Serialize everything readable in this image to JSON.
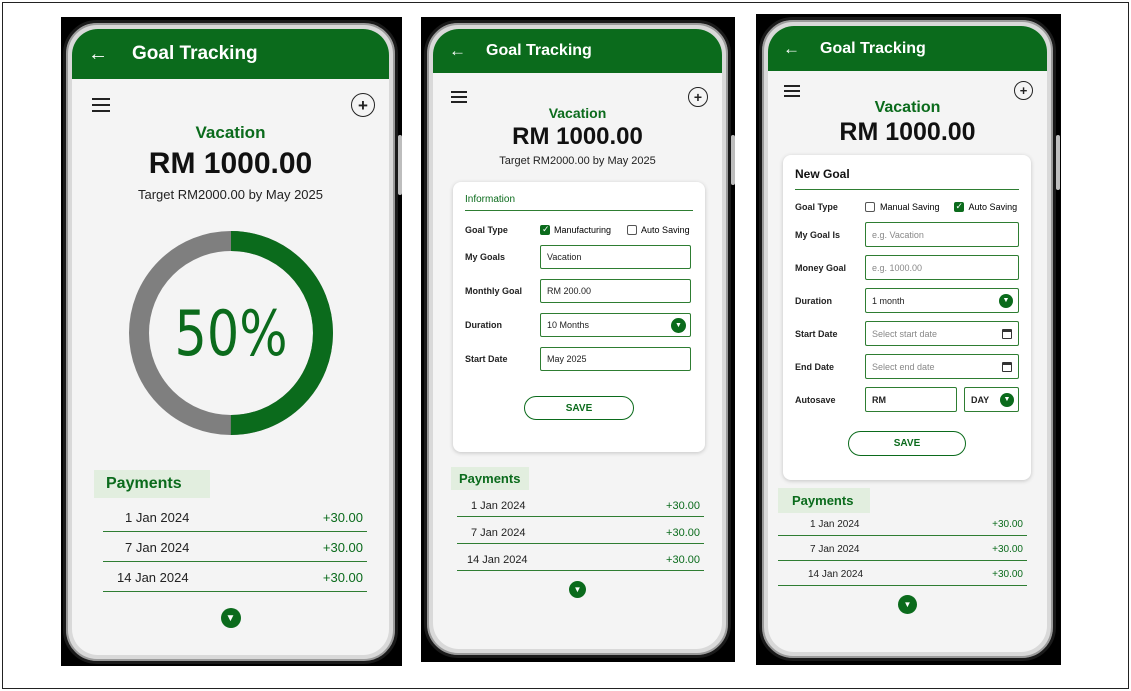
{
  "theme": {
    "primary": "#0b6b1c",
    "ring_gray": "#7f7f7f",
    "payments_bg": "#e2eedf"
  },
  "screen1": {
    "title": "Goal Tracking",
    "goal_name": "Vacation",
    "amount": "RM 1000.00",
    "target": "Target RM2000.00 by May 2025",
    "progress_label": "50%",
    "progress_fraction": 0.5,
    "payments_title": "Payments",
    "payments": [
      {
        "date": "1 Jan 2024",
        "amount": "+30.00"
      },
      {
        "date": "7 Jan 2024",
        "amount": "+30.00"
      },
      {
        "date": "14 Jan 2024",
        "amount": "+30.00"
      }
    ]
  },
  "screen2": {
    "title": "Goal Tracking",
    "goal_name": "Vacation",
    "amount": "RM 1000.00",
    "target": "Target RM2000.00 by May 2025",
    "card_title": "Information",
    "goal_type_label": "Goal Type",
    "option_a": "Manufacturing",
    "option_b": "Auto Saving",
    "my_goals_label": "My Goals",
    "my_goals_value": "Vacation",
    "monthly_goal_label": "Monthly Goal",
    "monthly_goal_value": "RM 200.00",
    "duration_label": "Duration",
    "duration_value": "10 Months",
    "start_date_label": "Start Date",
    "start_date_value": "May 2025",
    "save_label": "SAVE",
    "payments_title": "Payments",
    "payments": [
      {
        "date": "1 Jan 2024",
        "amount": "+30.00"
      },
      {
        "date": "7 Jan 2024",
        "amount": "+30.00"
      },
      {
        "date": "14 Jan 2024",
        "amount": "+30.00"
      }
    ]
  },
  "screen3": {
    "title": "Goal Tracking",
    "goal_name": "Vacation",
    "amount": "RM 1000.00",
    "card_title": "New Goal",
    "goal_type_label": "Goal Type",
    "option_a": "Manual Saving",
    "option_b": "Auto Saving",
    "my_goal_label": "My Goal Is",
    "my_goal_placeholder": "e.g. Vacation",
    "money_goal_label": "Money Goal",
    "money_goal_placeholder": "e.g. 1000.00",
    "duration_label": "Duration",
    "duration_value": "1 month",
    "start_date_label": "Start Date",
    "start_date_placeholder": "Select start date",
    "end_date_label": "End Date",
    "end_date_placeholder": "Select end date",
    "autosave_label": "Autosave",
    "autosave_currency": "RM",
    "autosave_period": "DAY",
    "save_label": "SAVE",
    "payments_title": "Payments",
    "payments": [
      {
        "date": "1 Jan 2024",
        "amount": "+30.00"
      },
      {
        "date": "7 Jan 2024",
        "amount": "+30.00"
      },
      {
        "date": "14 Jan 2024",
        "amount": "+30.00"
      }
    ]
  }
}
